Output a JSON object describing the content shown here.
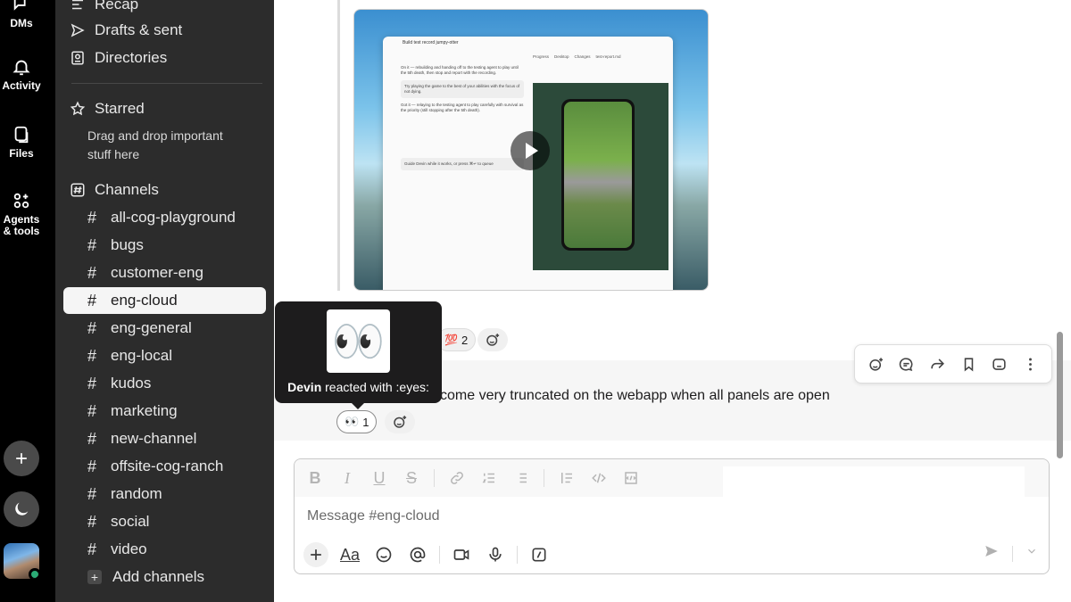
{
  "rail": {
    "dms_label": "DMs",
    "activity_label": "Activity",
    "files_label": "Files",
    "agents_label": "Agents & tools"
  },
  "sidebar": {
    "recap_label": "Recap",
    "drafts_label": "Drafts & sent",
    "directories_label": "Directories",
    "starred_label": "Starred",
    "starred_hint": "Drag and drop important stuff here",
    "channels_label": "Channels",
    "channels": [
      "all-cog-playground",
      "bugs",
      "customer-eng",
      "eng-cloud",
      "eng-general",
      "eng-local",
      "kudos",
      "marketing",
      "new-channel",
      "offsite-cog-ranch",
      "random",
      "social",
      "video"
    ],
    "active_channel": "eng-cloud",
    "add_channels_label": "Add channels"
  },
  "video": {
    "title": "Build test record jumpy-otter",
    "bubble_1": "Try playing the game to the best of your abilities with the focus of not dying.",
    "text_1": "On it — rebuilding and handing off to the testing agent to play until the 5th death, then stop and report with the recording.",
    "text_2": "Got it — relaying to the testing agent to play carefully with survival as the priority (still stopping after the 5th death).",
    "input_hint": "Guide Devin while it works, or press ⌘↵ to queue",
    "tab_progress": "Progress",
    "tab_desktop": "Desktop",
    "tab_changes": "Changes",
    "tab_file": "test-report.md"
  },
  "reactions": {
    "top_count": "2",
    "top_emoji": "💯",
    "eyes_emoji": "👀",
    "eyes_count": "1"
  },
  "message": {
    "text": "come very truncated on the webapp when all panels are open"
  },
  "tooltip": {
    "emoji": "👀",
    "user": "Devin",
    "action": " reacted with :eyes:"
  },
  "composer": {
    "placeholder": "Message #eng-cloud",
    "aa_label": "Aa"
  }
}
